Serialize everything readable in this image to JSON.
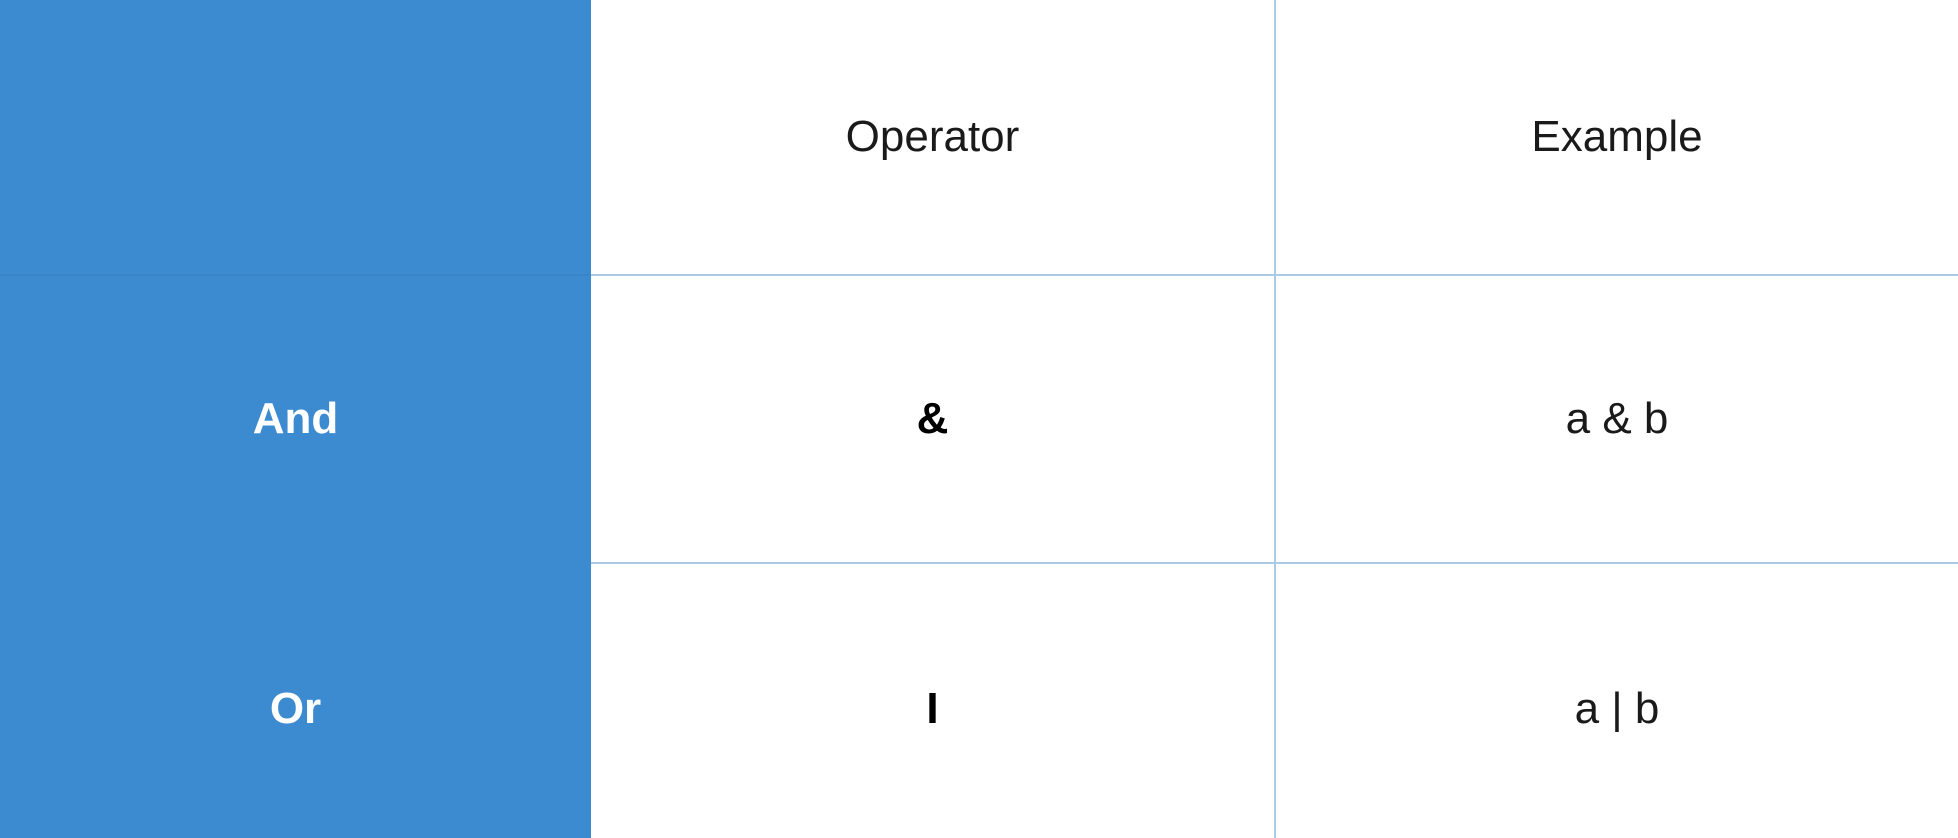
{
  "table": {
    "headers": [
      "",
      "Operator",
      "Example"
    ],
    "rows": [
      {
        "label": "And",
        "operator": "&",
        "example": "a & b"
      },
      {
        "label": "Or",
        "operator": "I",
        "example": "a | b"
      }
    ]
  },
  "colors": {
    "side_column": "#3c8acf",
    "grid_line": "#a9cbe6",
    "label_text": "#ffffff",
    "body_text": "#1a1a1a"
  }
}
